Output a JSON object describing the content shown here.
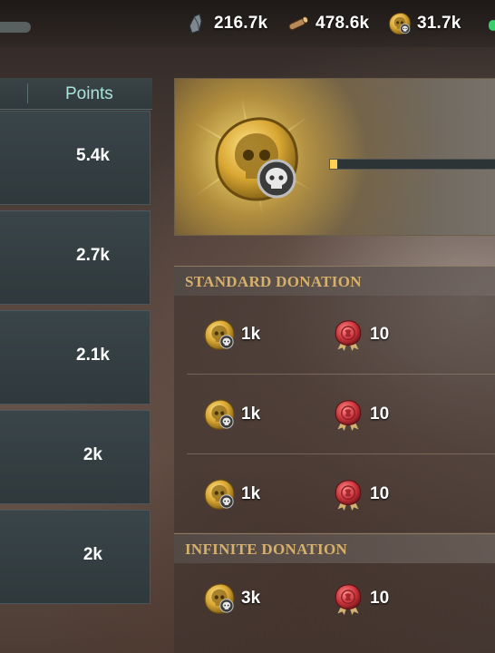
{
  "resources": [
    {
      "icon": "stone-resource-icon",
      "value": "216.7k"
    },
    {
      "icon": "wood-resource-icon",
      "value": "478.6k"
    },
    {
      "icon": "gold-coin-resource-icon",
      "value": "31.7k"
    }
  ],
  "ranking": {
    "header": "Points",
    "rows": [
      "5.4k",
      "2.7k",
      "2.1k",
      "2k",
      "2k"
    ]
  },
  "reward": {
    "icon": "skull-coin-icon",
    "progress_fraction": 0.04
  },
  "standard_donation": {
    "title": "STANDARD DONATION",
    "rows": [
      {
        "cost": "1k",
        "reward": "10"
      },
      {
        "cost": "1k",
        "reward": "10"
      },
      {
        "cost": "1k",
        "reward": "10"
      }
    ]
  },
  "infinite_donation": {
    "title": "INFINITE DONATION",
    "rows": [
      {
        "cost": "3k",
        "reward": "10"
      }
    ]
  },
  "colors": {
    "accent_gold": "#d6b06d",
    "points_header": "#a9e3d8",
    "progress_fill": "#ffcf55"
  }
}
